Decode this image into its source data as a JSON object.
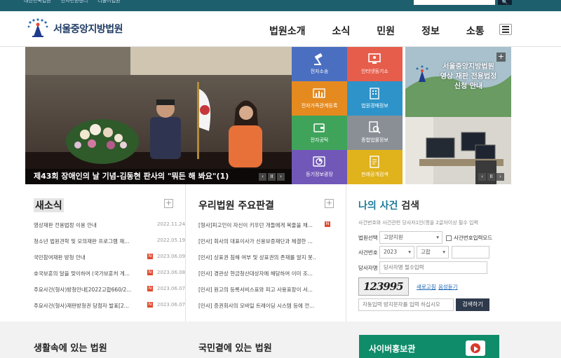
{
  "topbar": {
    "links": [
      "대한민국법원",
      "전자민원센터",
      "더불어법원"
    ],
    "search_button": "🔍"
  },
  "header": {
    "logo_text": "서울중앙지방법원",
    "nav": [
      "법원소개",
      "소식",
      "민원",
      "정보",
      "소통"
    ]
  },
  "hero": {
    "caption": "제43회 장애인의 날 기념-김동현 판사의 \"뭐든 해 봐요\"(1)",
    "ctrl_prev": "‹",
    "ctrl_pause": "II",
    "ctrl_next": "›"
  },
  "tiles": [
    {
      "label": "전자소송",
      "color": "#4a6fc1",
      "icon": "gavel-icon"
    },
    {
      "label": "인터넷등기소",
      "color": "#e65d4b",
      "icon": "monitor-icon"
    },
    {
      "label": "전자가족관계등록",
      "color": "#e58a1f",
      "icon": "family-chart-icon"
    },
    {
      "label": "법원경매정보",
      "color": "#2e93c9",
      "icon": "building-icon"
    },
    {
      "label": "전자공탁",
      "color": "#3fa45a",
      "icon": "wallet-icon"
    },
    {
      "label": "종합법률정보",
      "color": "#8a8f96",
      "icon": "search-doc-icon"
    },
    {
      "label": "등기정보광장",
      "color": "#7158b8",
      "icon": "chart-icon"
    },
    {
      "label": "판례공개검색",
      "color": "#e0b21c",
      "icon": "document-icon"
    }
  ],
  "promo": {
    "title_line1": "서울중앙지방법원",
    "title_line2": "영상 재판 전용법정",
    "title_line3": "신청 안내",
    "plus": "+"
  },
  "news": {
    "title": "새소식",
    "plus": "+",
    "items": [
      {
        "title": "영상재판 전용법정 이용 안내",
        "new": "",
        "date": "2022.11.24"
      },
      {
        "title": "청소년 법원견학 및 모의재판 프로그램 재...",
        "new": "",
        "date": "2022.05.19"
      },
      {
        "title": "국민참여재판 방청 안내",
        "new": "N",
        "date": "2023.06.09"
      },
      {
        "title": "호국보훈의 달을 맞이하여 (국가보훈처 게...",
        "new": "N",
        "date": "2023.06.08"
      },
      {
        "title": "주요사건(형사)방청안내[2022고합660/2...",
        "new": "N",
        "date": "2023.06.07"
      },
      {
        "title": "주요사건(형사)재판방청권 당첨자 발표[2...",
        "new": "N",
        "date": "2023.06.07"
      }
    ]
  },
  "rulings": {
    "title": "우리법원 주요판결",
    "plus": "+",
    "items": [
      {
        "title": "[형사]피고인이 자신이 키우던 개들에게 목줄을 채...",
        "new": "N"
      },
      {
        "title": "[민사] 회사의 대표이사가 신용보증재단과 체결한 ...",
        "new": ""
      },
      {
        "title": "[민사] 상표권 침해 여부 및 상표권의 존재를 알지 못...",
        "new": ""
      },
      {
        "title": "[민사] 경관상 현금청산대상자에 해당하여 이미 조...",
        "new": ""
      },
      {
        "title": "[민사] 원고의 등록서비스표와 피고 사용표장이 서...",
        "new": ""
      },
      {
        "title": "[민사] 증권회사의 모바일 트레이딩 시스템 등에 전...",
        "new": ""
      }
    ]
  },
  "case_search": {
    "title_highlight": "나의 사건",
    "title_rest": " 검색",
    "note": "사건번호와 사건관련 당사자1인(명을 2글자이상 필수 입력",
    "court_label": "법원선택",
    "court_value": "고양지원",
    "checkbox_label": "사건번호입력모드",
    "number_label": "사건번호",
    "year_value": "2023",
    "type_value": "고합",
    "party_label": "당사자명",
    "party_placeholder": "당사자명 필수입력",
    "captcha_text": "123995",
    "refresh_label": "새로고침",
    "audio_label": "음성듣기",
    "captcha_placeholder": "자동입력 방지문자를 입력 하십시오",
    "search_button": "검색하기"
  },
  "bottom": {
    "left_title": "생활속에 있는 법원",
    "mid_title": "국민곁에 있는 법원",
    "cyber_label": "사이버홍보관"
  }
}
